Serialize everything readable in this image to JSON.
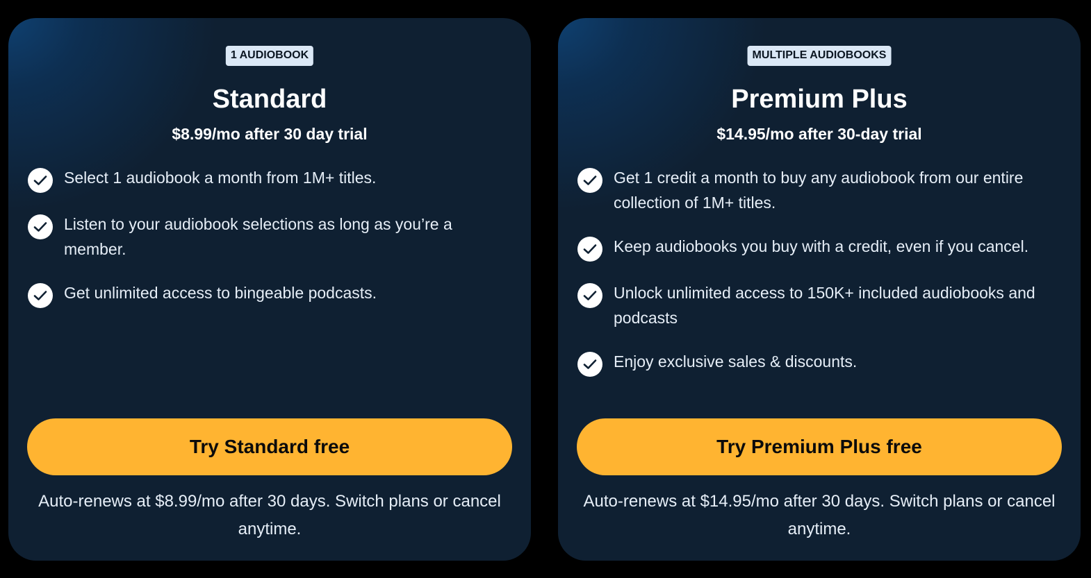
{
  "plans": [
    {
      "badge": "1 AUDIOBOOK",
      "name": "Standard",
      "price": "$8.99/mo after 30 day trial",
      "features": [
        "Select 1 audiobook a month from 1M+ titles.",
        "Listen to your audiobook selections as long as you’re a member.",
        "Get unlimited access to bingeable podcasts."
      ],
      "cta": "Try Standard free",
      "fineprint": "Auto-renews at $8.99/mo after 30 days. Switch plans or cancel anytime."
    },
    {
      "badge": "MULTIPLE AUDIOBOOKS",
      "name": "Premium Plus",
      "price": "$14.95/mo after 30-day trial",
      "features": [
        "Get 1 credit a month to buy any audiobook from our entire collection of 1M+ titles.",
        "Keep audiobooks you buy with a credit, even if you cancel.",
        "Unlock unlimited access to 150K+ included audiobooks and podcasts",
        "Enjoy exclusive sales & discounts."
      ],
      "cta": "Try Premium Plus free",
      "fineprint": "Auto-renews at $14.95/mo after 30 days. Switch plans or cancel anytime."
    }
  ],
  "icons": {
    "feature_check": "check-icon"
  },
  "colors": {
    "page_background": "#000000",
    "card_background": "#0f2032",
    "card_glow": "#0f4070",
    "badge_background": "#dbe8f6",
    "cta_background": "#ffb431",
    "text_primary": "#ffffff"
  }
}
